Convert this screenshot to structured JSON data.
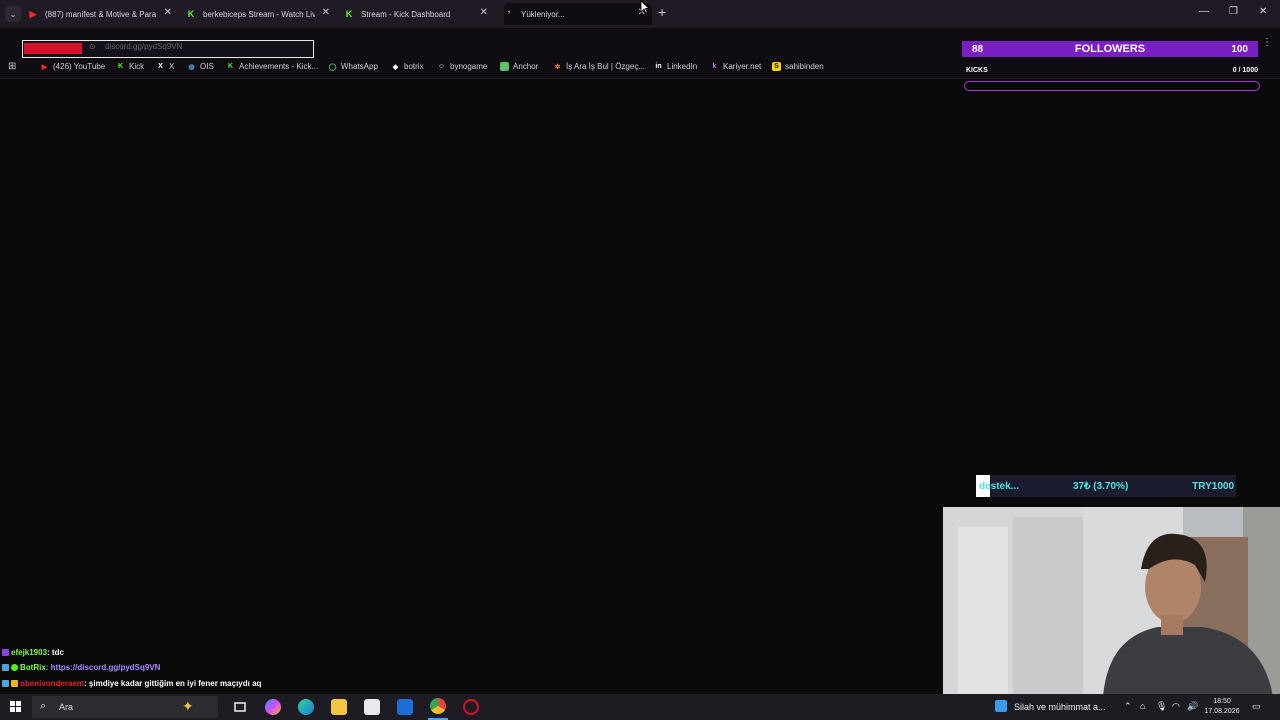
{
  "tabs": [
    {
      "title": "(887) manifest & Motive & Para",
      "icon": "youtube-icon"
    },
    {
      "title": "berkebiceps Stream - Watch Live",
      "icon": "kick-icon"
    },
    {
      "title": "Stream - Kick Dashboard",
      "icon": "kick-icon"
    },
    {
      "title": "Yükleniyor...",
      "icon": "loading-icon"
    }
  ],
  "address_bar": {
    "url": "discord.gg/pydSq9VN"
  },
  "bookmarks": [
    {
      "label": "(426) YouTube",
      "icon": "youtube-icon"
    },
    {
      "label": "Kick",
      "icon": "kick-icon"
    },
    {
      "label": "X",
      "icon": "x-icon"
    },
    {
      "label": "OIS",
      "icon": "globe-icon"
    },
    {
      "label": "Achievements - Kick...",
      "icon": "kick-icon"
    },
    {
      "label": "WhatsApp",
      "icon": "whatsapp-icon"
    },
    {
      "label": "botrix",
      "icon": "botrix-icon"
    },
    {
      "label": "bynogame",
      "icon": "bynogame-icon"
    },
    {
      "label": "Anchor",
      "icon": "anchor-icon"
    },
    {
      "label": "İş Ara İş Bul | Özgeç...",
      "icon": "kariyer-icon"
    },
    {
      "label": "LinkedIn",
      "icon": "linkedin-icon"
    },
    {
      "label": "Kariyer.net",
      "icon": "kariyernet-icon"
    },
    {
      "label": "sahibinden",
      "icon": "sahibinden-icon"
    }
  ],
  "followers_goal": {
    "current": "88",
    "label": "FOLLOWERS",
    "goal": "100"
  },
  "kicks_goal": {
    "label": "KICKS",
    "count": "0 / 1000",
    "progress": 0.0
  },
  "donation_goal": {
    "label": "destek...",
    "amount": "37₺ (3.70%)",
    "target": "TRY1000",
    "progress": 0.037
  },
  "chat": [
    {
      "user": "efejk1903",
      "message": " : tdc",
      "user_color": "#7cfc4a"
    },
    {
      "user": "BotRix",
      "message": " : https://discord.gg/pydSq9VN",
      "user_color": "#7cfc4a",
      "message_color": "#a88bff"
    },
    {
      "user": "obenivonderaem",
      "message": " : şimdiye kadar gittiğim en iyi fener maçıydı aq",
      "user_color": "#e0241f"
    }
  ],
  "taskbar": {
    "search_placeholder": "Ara",
    "news": "Silah ve mühimmat a...",
    "time": "18:50",
    "date": "17.08.2026"
  },
  "colors": {
    "kick_green": "#53fc18",
    "overlay_purple": "#7a1fc4",
    "cyan": "#4fe3e8"
  }
}
